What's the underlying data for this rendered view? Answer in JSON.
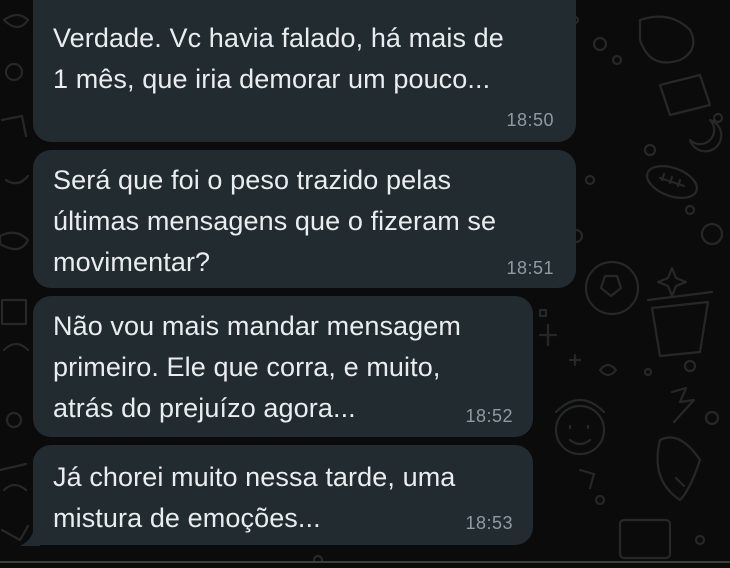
{
  "chat": {
    "messages": [
      {
        "text": "Verdade. Vc havia falado, há mais de\n1 mês, que iria demorar um pouco...",
        "time": "18:50"
      },
      {
        "text": "Será que foi o peso trazido pelas\núltimas mensagens que o fizeram se\nmovimentar?",
        "time": "18:51"
      },
      {
        "text": "Não vou mais mandar mensagem\nprimeiro. Ele que corra, e muito,\natrás do prejuízo agora...",
        "time": "18:52"
      },
      {
        "text": "Já chorei muito nessa tarde, uma\nmistura de emoções...",
        "time": "18:53"
      }
    ]
  },
  "colors": {
    "background": "#0b0b0b",
    "bubble": "#222b30",
    "text": "#e9edef",
    "timestamp": "#8f9aa1"
  }
}
